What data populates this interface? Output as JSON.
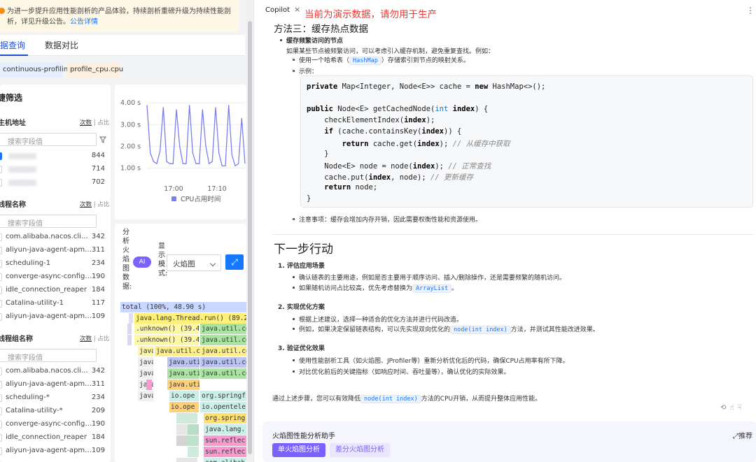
{
  "notice": {
    "line1": "为进一步提升应用性能剖析的产品体验，持续剖析重磅升级为持续性能剖",
    "line2": "析，详见升级公告。",
    "link": "公告详情"
  },
  "tabs": [
    "据查询",
    "数据对比"
  ],
  "tags": [
    "continuous-profiling",
    "profile_cpu.cpu"
  ],
  "quick_filter": {
    "title": "捷筛选",
    "toggle": {
      "count": "次数",
      "ratio": "占比"
    },
    "search_placeholder": "搜索字段值",
    "host": {
      "title": "主机地址",
      "rows": [
        {
          "label": "",
          "count": "844"
        },
        {
          "label": "",
          "count": "714"
        },
        {
          "label": "",
          "count": "702"
        }
      ]
    },
    "thread": {
      "title": "线程名称",
      "rows": [
        {
          "label": "com.alibaba.nacos.client....",
          "count": "342"
        },
        {
          "label": "aliyun-java-agent-apm-A...",
          "count": "311"
        },
        {
          "label": "scheduling-1",
          "count": "234"
        },
        {
          "label": "converge-async-config-p...",
          "count": "190"
        },
        {
          "label": "idle_connection_reaper",
          "count": "184"
        },
        {
          "label": "Catalina-utility-1",
          "count": "117"
        },
        {
          "label": "aliyun-java-agent-apm-A...",
          "count": "109"
        }
      ]
    },
    "thread_group": {
      "title": "线程组名称",
      "rows": [
        {
          "label": "com.alibaba.nacos.client....",
          "count": "342"
        },
        {
          "label": "aliyun-java-agent-apm-A...",
          "count": "311"
        },
        {
          "label": "scheduling-*",
          "count": "234"
        },
        {
          "label": "Catalina-utility-*",
          "count": "209"
        },
        {
          "label": "converge-async-config-p...",
          "count": "190"
        },
        {
          "label": "idle_connection_reaper",
          "count": "184"
        },
        {
          "label": "aliyun-java-agent-apm-A...",
          "count": "109"
        }
      ]
    }
  },
  "chart_data": {
    "type": "line",
    "y_ticks": [
      "4.00 s",
      "3.00 s",
      "2.00 s",
      "1.00 s"
    ],
    "ylim": [
      0.5,
      4.2
    ],
    "x_ticks": [
      "17:00",
      "17:10"
    ],
    "series": [
      {
        "name": "CPU占用时间",
        "color": "#7b7ff0",
        "values": [
          3.9,
          1.7,
          1.3,
          1.2,
          1.8,
          3.8,
          1.3,
          1.2,
          1.2,
          3.7,
          2.0,
          1.2,
          1.2,
          3.9,
          1.7,
          1.2,
          1.2,
          3.7,
          2.0,
          1.2,
          1.3,
          3.8,
          1.7,
          1.1,
          1.1,
          3.9,
          1.6,
          1.1,
          1.2,
          3.3,
          1.2
        ]
      }
    ]
  },
  "flame": {
    "label": "分析火焰图数据:",
    "ai_button": "AI",
    "mode_label": "显示模式:",
    "mode_value": "火焰图",
    "frames": [
      {
        "text": "total (100%, 48.90 s)"
      },
      {
        "text": "java.lang.Thread.run() (89.28"
      },
      {
        "text": ".unknown() (39.4"
      },
      {
        "text": "java.util.co"
      },
      {
        "text": ".unknown() (39.4"
      },
      {
        "text": "java.util.co"
      },
      {
        "text": "java.util.co"
      },
      {
        "text": "java.util.co"
      },
      {
        "text": "java.util.co"
      },
      {
        "text": "java.util.co"
      },
      {
        "text": "java.util.co"
      },
      {
        "text": "java.util.co"
      },
      {
        "text": "java.util.co"
      },
      {
        "text": "io.ope"
      },
      {
        "text": "org.springf"
      },
      {
        "text": "io.ope"
      },
      {
        "text": "io.opentele"
      },
      {
        "text": "org.spring"
      },
      {
        "text": "java.lang."
      },
      {
        "text": "sun.reflec"
      },
      {
        "text": "sun.reflec"
      },
      {
        "text": "com.alibab"
      },
      {
        "text": "java"
      },
      {
        "text": "java"
      },
      {
        "text": "java"
      },
      {
        "text": "java"
      },
      {
        "text": "java"
      },
      {
        "text": "java.uti"
      },
      {
        "text": "java.uti"
      },
      {
        "text": "java.uti"
      }
    ]
  },
  "copilot": {
    "tab": "Copilot",
    "watermark": "当前为演示数据，请勿用于生产",
    "section3_title": "方法三：缓存热点数据",
    "bullet_title": "缓存频繁访问的节点",
    "bullet_desc": "如果某些节点被频繁访问，可以考虑引入缓存机制，避免重复查找。例如：",
    "sub1_pre": "使用一个哈希表（",
    "sub1_code": "HashMap",
    "sub1_post": "）存储索引到节点的映射关系。",
    "sub2": "示例：",
    "code": [
      "private Map<Integer, Node<E>> cache = new HashMap<>();",
      "",
      "public Node<E> getCachedNode(int index) {",
      "    checkElementIndex(index);",
      "    if (cache.containsKey(index)) {",
      "        return cache.get(index); // 从缓存中获取",
      "    }",
      "    Node<E> node = node(index); // 正常查找",
      "    cache.put(index, node); // 更新缓存",
      "    return node;",
      "}"
    ],
    "note": "注意事项：缓存会增加内存开销，因此需要权衡性能和资源使用。",
    "next_title": "下一步行动",
    "steps": [
      {
        "title": "1. 评估应用场景",
        "items": [
          {
            "text": "确认链表的主要用途，例如是否主要用于顺序访问、插入/删除操作，还是需要频繁的随机访问。"
          },
          {
            "pre": "如果随机访问占比较高，优先考虑替换为",
            "code": "ArrayList",
            "post": "。"
          }
        ]
      },
      {
        "title": "2. 实现优化方案",
        "items": [
          {
            "text": "根据上述建议，选择一种适合的优化方法并进行代码改造。"
          },
          {
            "pre": "例如，如果决定保留链表结构，可以先实现双向优化的",
            "code": "node(int index)",
            "post": "方法，并测试其性能改进效果。"
          }
        ]
      },
      {
        "title": "3. 验证优化效果",
        "items": [
          {
            "text": "使用性能剖析工具（如火焰图、JProfiler等）重新分析优化后的代码，确保CPU占用率有所下降。"
          },
          {
            "text": "对比优化前后的关键指标（如响应时间、吞吐量等），确认优化的实际效果。"
          }
        ]
      }
    ],
    "summary_pre": "通过上述步骤，您可以有效降低",
    "summary_code": "node(int index)",
    "summary_post": "方法的CPU开销，从而提升整体应用性能。",
    "assistant_title": "火焰图性能分析助手",
    "recommend": "推荐",
    "chip_single": "单火焰图分析",
    "chip_diff": "差分火焰图分析"
  }
}
